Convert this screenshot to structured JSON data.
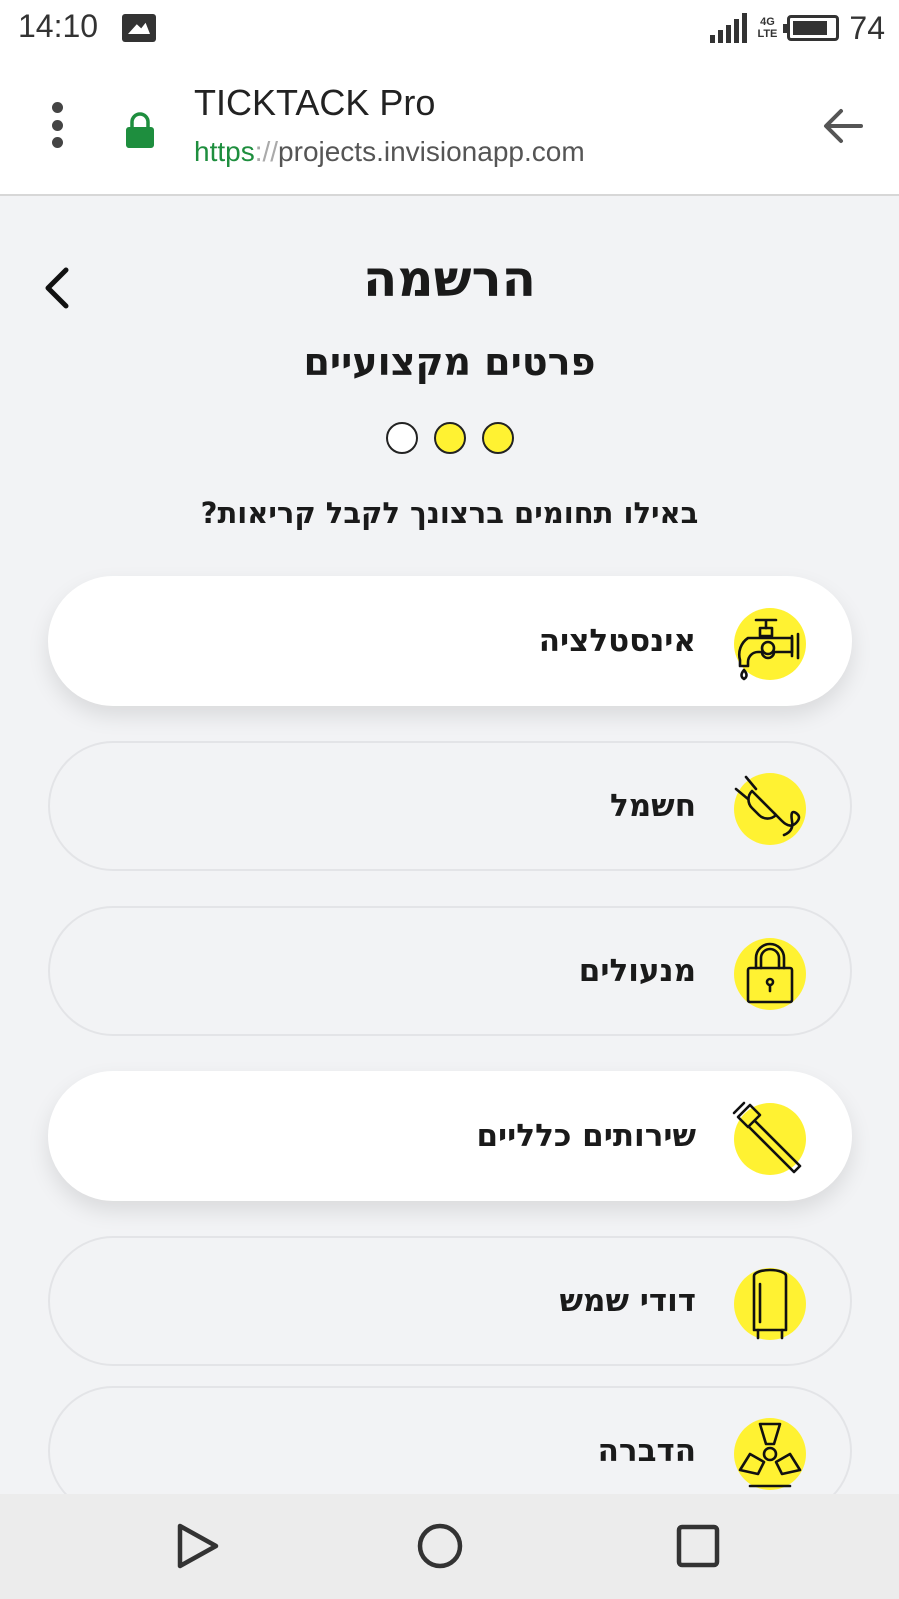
{
  "status_bar": {
    "time": "14:10",
    "network": "4G",
    "network_sub": "LTE",
    "battery": "74"
  },
  "browser": {
    "title": "TICKTACK Pro",
    "url_scheme": "https",
    "url_sep": "://",
    "url_host": "projects.invisionapp.com"
  },
  "page": {
    "title": "הרשמה",
    "subtitle": "פרטים מקצועיים",
    "question": "באילו תחומים ברצונך לקבל קריאות?",
    "steps": [
      {
        "state": "done"
      },
      {
        "state": "done"
      },
      {
        "state": "todo"
      }
    ],
    "categories": [
      {
        "label": "אינסטלציה",
        "icon": "faucet-icon",
        "selected": true
      },
      {
        "label": "חשמל",
        "icon": "plug-icon",
        "selected": false
      },
      {
        "label": "מנעולים",
        "icon": "padlock-icon",
        "selected": false
      },
      {
        "label": "שירותים כלליים",
        "icon": "hammer-icon",
        "selected": true
      },
      {
        "label": "דודי שמש",
        "icon": "water-heater-icon",
        "selected": false
      },
      {
        "label": "הדברה",
        "icon": "hazard-icon",
        "selected": false
      }
    ]
  },
  "colors": {
    "accent_yellow": "#fff232",
    "lock_green": "#1e8e3e",
    "background": "#f2f3f5"
  }
}
